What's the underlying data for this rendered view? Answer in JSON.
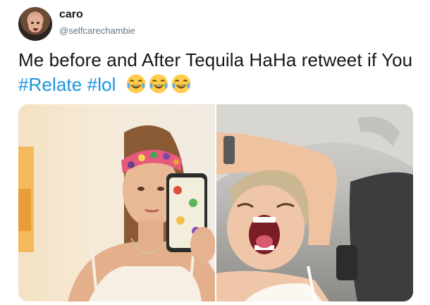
{
  "tweet": {
    "author": {
      "name": "caro",
      "handle": "@selfcarechambie"
    },
    "text": {
      "plain": "Me before and After Tequila HaHa retweet if You",
      "hashtags": [
        "#Relate",
        "#lol"
      ],
      "emoji": [
        "face-with-tears-of-joy",
        "face-with-tears-of-joy",
        "face-with-tears-of-joy"
      ]
    },
    "media": [
      {
        "name": "photo-before",
        "description_icon": "photo"
      },
      {
        "name": "photo-after",
        "description_icon": "photo"
      }
    ]
  },
  "colors": {
    "text": "#14171a",
    "secondary": "#657786",
    "link": "#1b95e0"
  }
}
